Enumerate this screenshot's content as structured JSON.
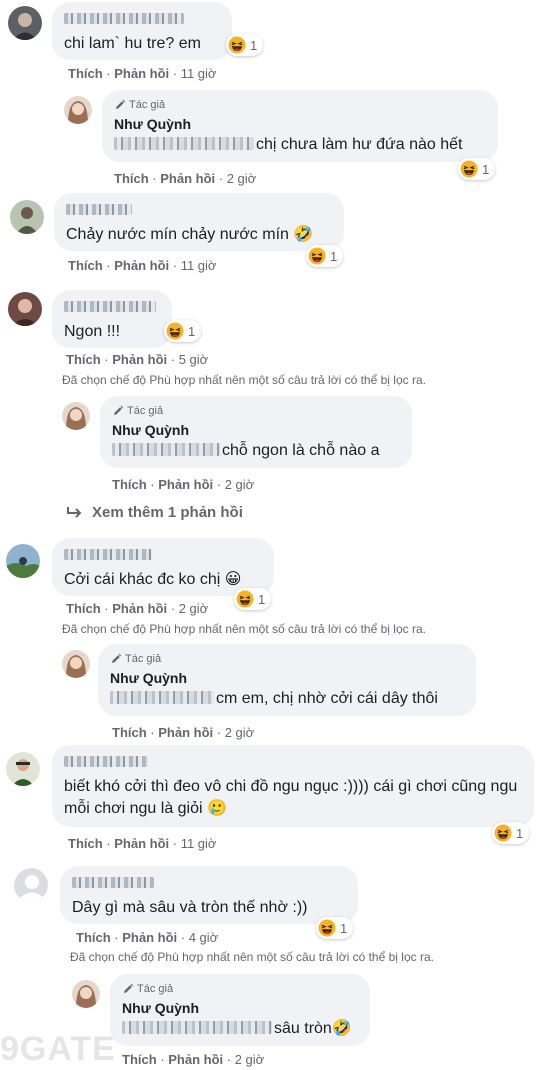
{
  "colors": {
    "bubble": "#f0f2f5",
    "meta": "#65676b",
    "text": "#1c1e21",
    "emoji": "#f7b125"
  },
  "labels": {
    "like": "Thích",
    "reply": "Phản hồi",
    "author_badge": "Tác giả"
  },
  "comments": [
    {
      "text": "chi lam` hu tre? em",
      "time": "11 giờ",
      "reaction_icon": "haha-emoji",
      "reaction_count": "1"
    },
    {
      "author": "Như Quỳnh",
      "text": "chị chưa làm hư đứa nào hết",
      "time": "2 giờ",
      "reaction_icon": "haha-emoji",
      "reaction_count": "1"
    },
    {
      "text": "Chảy nước mín chảy nước mín 🤣",
      "time": "11 giờ",
      "reaction_icon": "haha-emoji",
      "reaction_count": "1"
    },
    {
      "text": "Ngon !!!",
      "time": "5 giờ",
      "reaction_icon": "haha-emoji",
      "reaction_count": "1"
    },
    {
      "author": "Như Quỳnh",
      "text": "chỗ ngon là chỗ nào a",
      "time": "2 giờ"
    },
    {
      "text": "Cởi cái khác đc ko chị 😀",
      "time": "2 giờ",
      "reaction_icon": "haha-emoji",
      "reaction_count": "1"
    },
    {
      "author": "Như Quỳnh",
      "text": "cm em, chị nhờ cởi cái dây thôi",
      "time": "2 giờ"
    },
    {
      "text": "biết khó cởi thì đeo vô chi đồ ngu ngục :)))) cái gì chơi cũng ngu mỗi chơi ngu là giỏi 🥲",
      "time": "11 giờ",
      "reaction_icon": "haha-emoji",
      "reaction_count": "1"
    },
    {
      "text": "Dây gì mà sâu và tròn thế nhờ :))",
      "time": "4 giờ",
      "reaction_icon": "haha-emoji",
      "reaction_count": "1"
    },
    {
      "author": "Như Quỳnh",
      "text": "sâu tròn🤣",
      "time": "2 giờ"
    }
  ],
  "filter_note": "Đã chọn chế độ Phù hợp nhất nên một số câu trả lời có thể bị lọc ra.",
  "see_more": "Xem thêm 1 phản hồi",
  "watermark": "9GATE"
}
